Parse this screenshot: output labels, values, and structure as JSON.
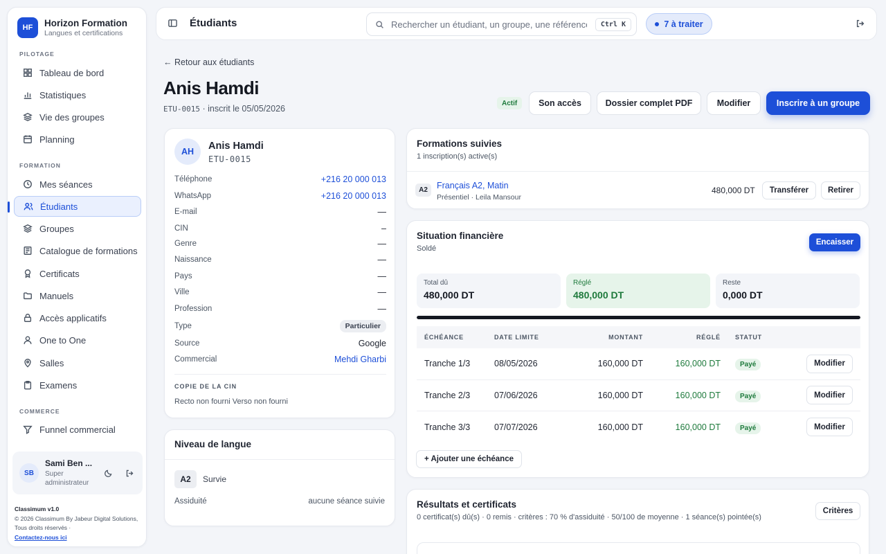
{
  "brand": {
    "initials": "HF",
    "name": "Horizon Formation",
    "subtitle": "Langues et certifications"
  },
  "sidebar": {
    "sections": {
      "pilotage": "PILOTAGE",
      "formation": "FORMATION",
      "commerce": "COMMERCE"
    },
    "items": [
      {
        "label": "Tableau de bord",
        "icon": "grid-icon"
      },
      {
        "label": "Statistiques",
        "icon": "bar-chart-icon"
      },
      {
        "label": "Vie des groupes",
        "icon": "layers-icon"
      },
      {
        "label": "Planning",
        "icon": "calendar-icon"
      },
      {
        "label": "Mes séances",
        "icon": "clock-icon"
      },
      {
        "label": "Étudiants",
        "icon": "users-icon",
        "active": true
      },
      {
        "label": "Groupes",
        "icon": "layers-icon"
      },
      {
        "label": "Catalogue de formations",
        "icon": "book-icon"
      },
      {
        "label": "Certificats",
        "icon": "award-icon"
      },
      {
        "label": "Manuels",
        "icon": "folder-icon"
      },
      {
        "label": "Accès applicatifs",
        "icon": "lock-icon"
      },
      {
        "label": "One to One",
        "icon": "user-icon"
      },
      {
        "label": "Salles",
        "icon": "pin-icon"
      },
      {
        "label": "Examens",
        "icon": "clipboard-icon"
      },
      {
        "label": "Funnel commercial",
        "icon": "funnel-icon"
      }
    ]
  },
  "user": {
    "initials": "SB",
    "name": "Sami Ben ...",
    "role": "Super administrateur"
  },
  "footer": {
    "version": "Classimum v1.0",
    "copyright": "© 2026 Classimum By Jabeur Digital Solutions, Tous droits réservés ·",
    "contact": "Contactez-nous ici"
  },
  "topbar": {
    "title": "Étudiants",
    "search_placeholder": "Rechercher un étudiant, un groupe, une référence",
    "shortcut": "Ctrl K",
    "todo": "7 à traiter"
  },
  "header": {
    "back": "← Retour aux étudiants",
    "name": "Anis Hamdi",
    "code": "ETU-0015",
    "inscribed": " · inscrit le 05/05/2026",
    "status": "Actif",
    "btn_access": "Son accès",
    "btn_pdf": "Dossier complet PDF",
    "btn_edit": "Modifier",
    "btn_enroll": "Inscrire à un groupe"
  },
  "profile": {
    "initials": "AH",
    "name": "Anis Hamdi",
    "code": "ETU-0015",
    "fields": [
      {
        "label": "Téléphone",
        "value": "+216 20 000 013",
        "kind": "link"
      },
      {
        "label": "WhatsApp",
        "value": "+216 20 000 013",
        "kind": "link"
      },
      {
        "label": "E-mail",
        "value": "—"
      },
      {
        "label": "CIN",
        "value": "–"
      },
      {
        "label": "Genre",
        "value": "—"
      },
      {
        "label": "Naissance",
        "value": "—"
      },
      {
        "label": "Pays",
        "value": "—"
      },
      {
        "label": "Ville",
        "value": "—"
      },
      {
        "label": "Profession",
        "value": "—"
      },
      {
        "label": "Type",
        "value": "Particulier",
        "kind": "pill"
      },
      {
        "label": "Source",
        "value": "Google"
      },
      {
        "label": "Commercial",
        "value": "Mehdi Gharbi",
        "kind": "link"
      }
    ],
    "cin_title": "COPIE DE LA CIN",
    "cin_status": "Recto non fourni Verso non fourni"
  },
  "language": {
    "title": "Niveau de langue",
    "level": "A2",
    "level_name": "Survie",
    "attendance_label": "Assiduité",
    "attendance_value": "aucune séance suivie"
  },
  "formations": {
    "title": "Formations suivies",
    "subtitle": "1 inscription(s) active(s)",
    "item": {
      "level": "A2",
      "name": "Français A2, Matin",
      "detail": "Présentiel · Leila Mansour",
      "price": "480,000 DT",
      "btn_transfer": "Transférer",
      "btn_remove": "Retirer"
    }
  },
  "finance": {
    "title": "Situation financière",
    "subtitle": "Soldé",
    "btn_collect": "Encaisser",
    "total_label": "Total dû",
    "total_value": "480,000 DT",
    "paid_label": "Réglé",
    "paid_value": "480,000 DT",
    "rest_label": "Reste",
    "rest_value": "0,000 DT",
    "progress": 1.0,
    "columns": [
      "ÉCHÉANCE",
      "DATE LIMITE",
      "MONTANT",
      "RÉGLÉ",
      "STATUT"
    ],
    "rows": [
      {
        "name": "Tranche 1/3",
        "date": "08/05/2026",
        "amount": "160,000 DT",
        "paid": "160,000 DT",
        "status": "Payé",
        "action": "Modifier"
      },
      {
        "name": "Tranche 2/3",
        "date": "07/06/2026",
        "amount": "160,000 DT",
        "paid": "160,000 DT",
        "status": "Payé",
        "action": "Modifier"
      },
      {
        "name": "Tranche 3/3",
        "date": "07/07/2026",
        "amount": "160,000 DT",
        "paid": "160,000 DT",
        "status": "Payé",
        "action": "Modifier"
      }
    ],
    "btn_add": "+ Ajouter une échéance"
  },
  "results": {
    "title": "Résultats et certificats",
    "subtitle": "0 certificat(s) dû(s) · 0 remis · critères : 70 % d'assiduité · 50/100 de moyenne · 1 séance(s) pointée(s)",
    "btn_criteria": "Critères"
  },
  "colors": {
    "accent": "#1d4fd8",
    "success": "#1e7a3c",
    "background": "#f3f5f9"
  }
}
